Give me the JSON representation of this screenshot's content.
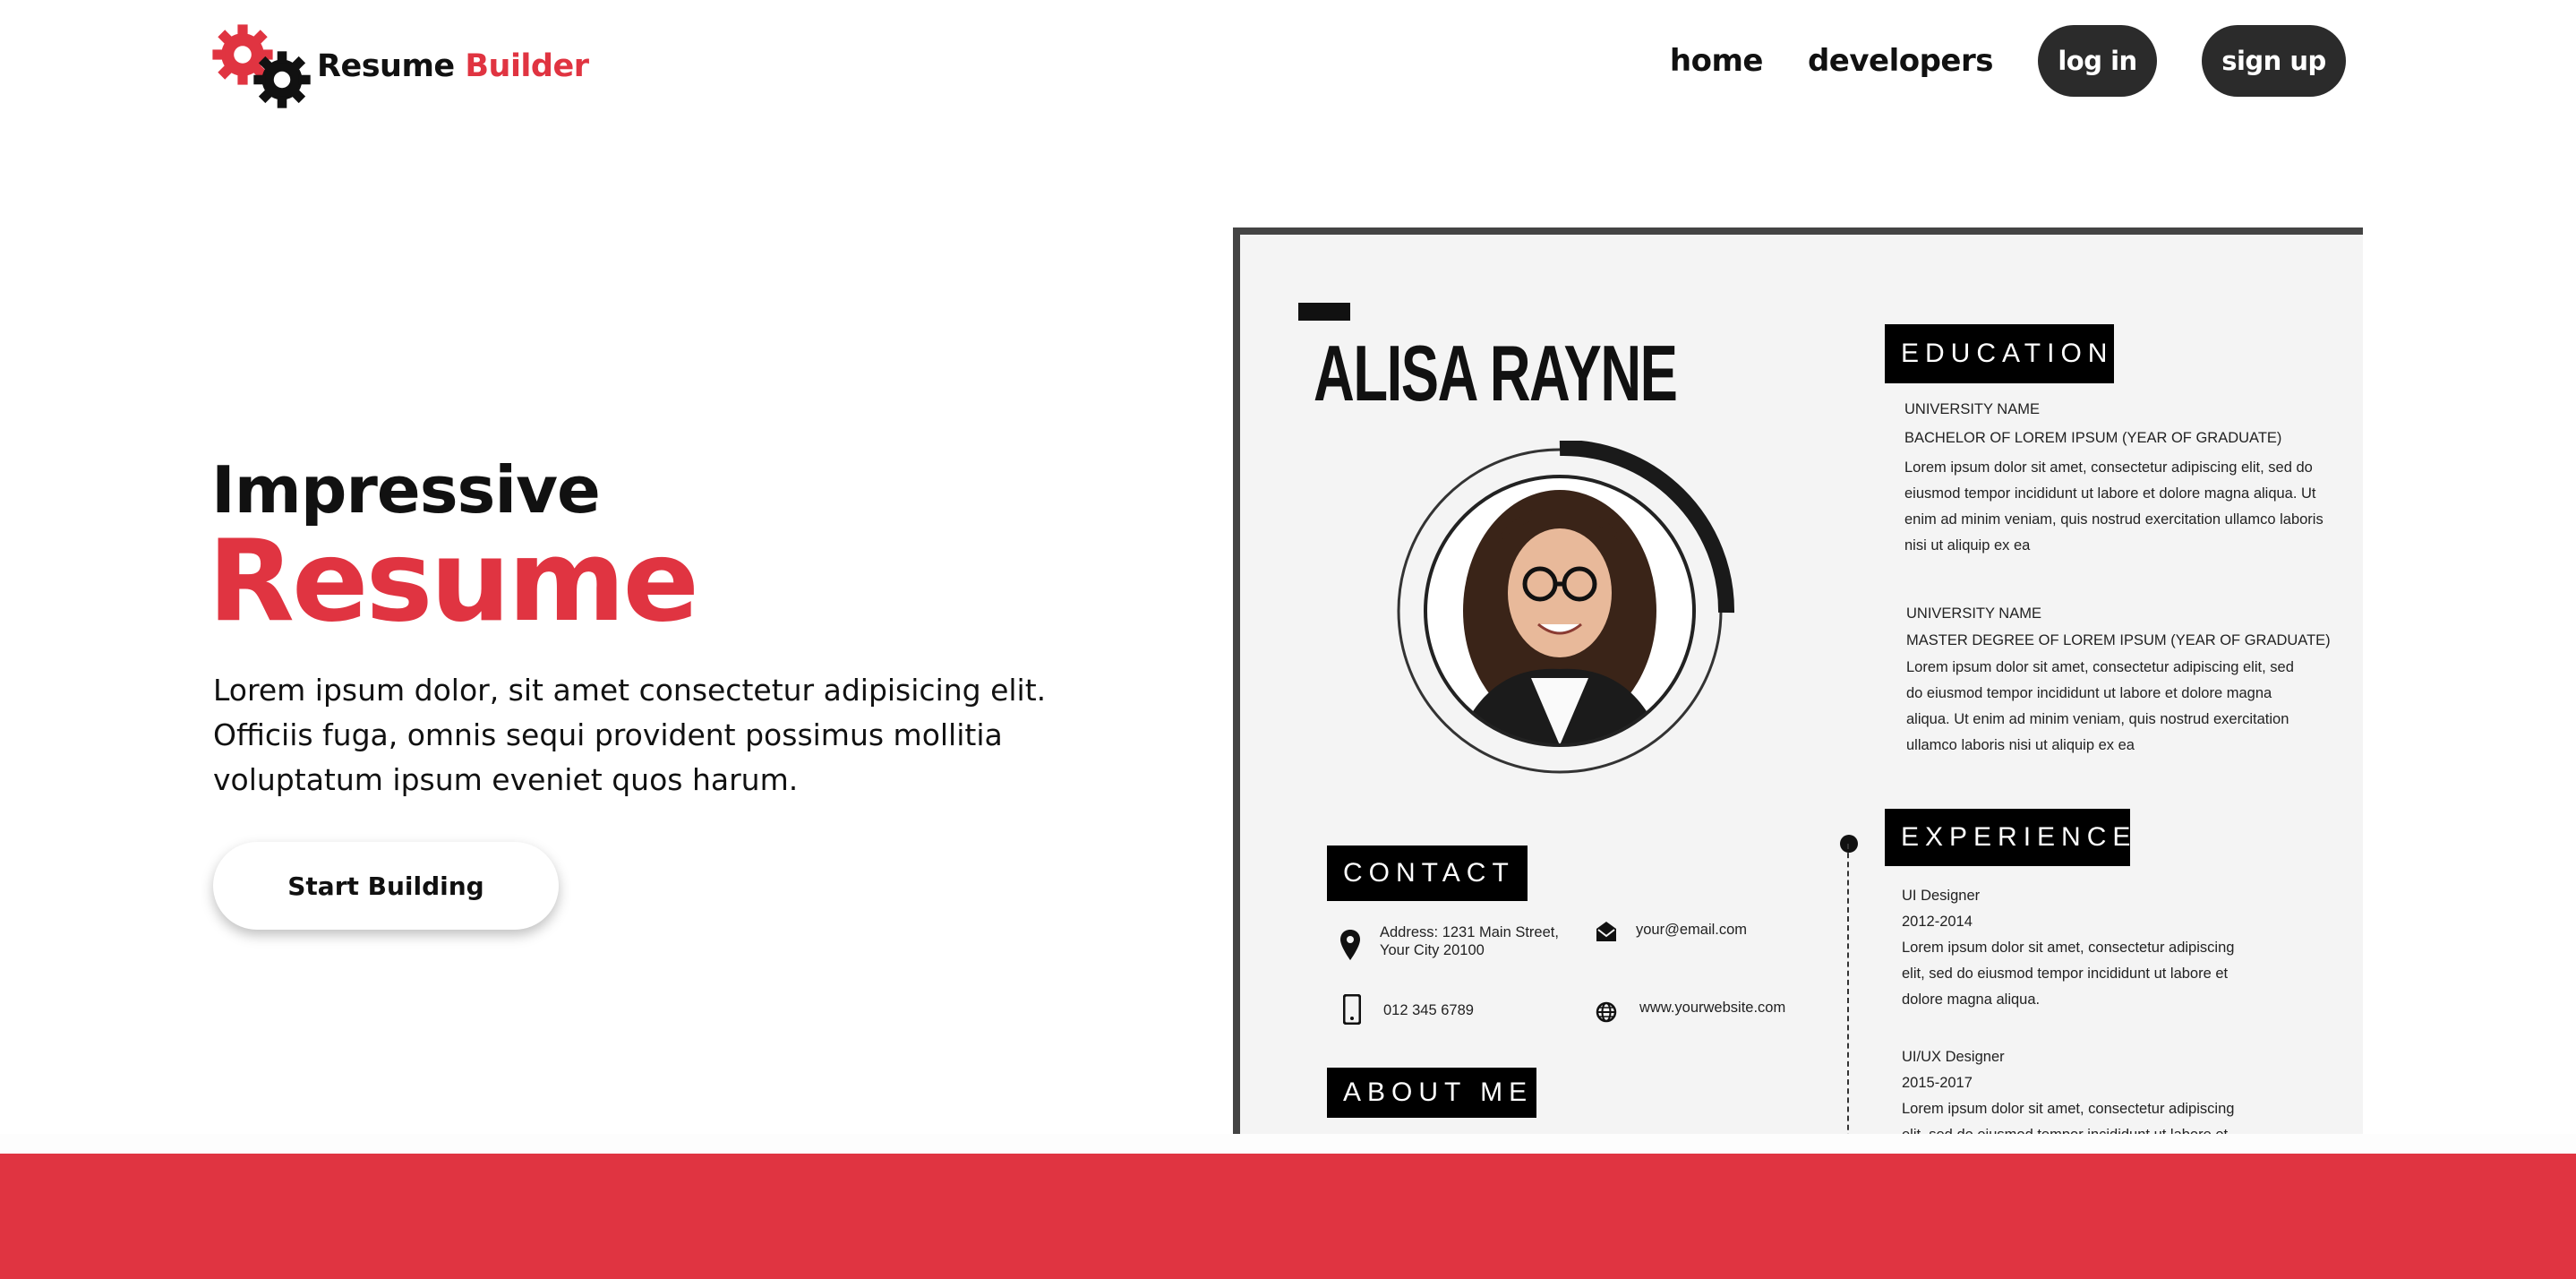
{
  "brand": {
    "name_part1": "Resume",
    "name_part2": "Builder",
    "colors": {
      "accent": "#e03441",
      "dark": "#2b2b2b"
    }
  },
  "nav": {
    "links": [
      "home",
      "developers"
    ],
    "login_label": "log in",
    "signup_label": "sign up"
  },
  "hero": {
    "subtitle": "Impressive",
    "title": "Resume",
    "description": "Lorem ipsum dolor, sit amet consectetur adipisicing elit. Officiis fuga, omnis sequi provident possimus mollitia voluptatum ipsum eveniet quos harum.",
    "cta_label": "Start Building"
  },
  "resume": {
    "name": "ALISA RAYNE",
    "education": {
      "heading": "EDUCATION",
      "items": [
        {
          "university": "UNIVERSITY NAME",
          "degree": "BACHELOR OF LOREM IPSUM (YEAR OF GRADUATE)",
          "lines": [
            "Lorem ipsum dolor sit amet, consectetur adipiscing elit, sed do",
            "eiusmod tempor incididunt ut labore et dolore magna aliqua. Ut",
            "enim ad minim veniam, quis nostrud exercitation ullamco laboris",
            "nisi ut aliquip ex ea"
          ]
        },
        {
          "university": "UNIVERSITY NAME",
          "degree": "MASTER DEGREE OF LOREM IPSUM (YEAR OF GRADUATE)",
          "lines": [
            "Lorem ipsum dolor sit amet, consectetur adipiscing elit, sed",
            "do eiusmod tempor incididunt ut labore et dolore magna",
            "aliqua. Ut enim ad minim veniam, quis nostrud exercitation",
            "ullamco laboris nisi ut aliquip ex ea"
          ]
        }
      ]
    },
    "experience": {
      "heading": "EXPERIENCE",
      "items": [
        {
          "role": "UI Designer",
          "years": "2012-2014",
          "lines": [
            "Lorem ipsum dolor sit amet, consectetur adipiscing",
            "elit, sed do eiusmod tempor incididunt ut labore et",
            "dolore magna aliqua."
          ]
        },
        {
          "role": "UI/UX Designer",
          "years": "2015-2017",
          "lines": [
            "Lorem ipsum dolor sit amet, consectetur adipiscing",
            "elit, sed do eiusmod tempor incididunt ut labore et"
          ]
        }
      ]
    },
    "contact": {
      "heading": "CONTACT",
      "address_line1": "Address: 1231 Main Street,",
      "address_line2": "Your City 20100",
      "phone": "012 345 6789",
      "email": "your@email.com",
      "website": "www.yourwebsite.com"
    },
    "about": {
      "heading": "ABOUT ME"
    }
  },
  "icons": [
    "gear-logo-icon",
    "location-pin-icon",
    "phone-icon",
    "envelope-icon",
    "globe-icon"
  ]
}
